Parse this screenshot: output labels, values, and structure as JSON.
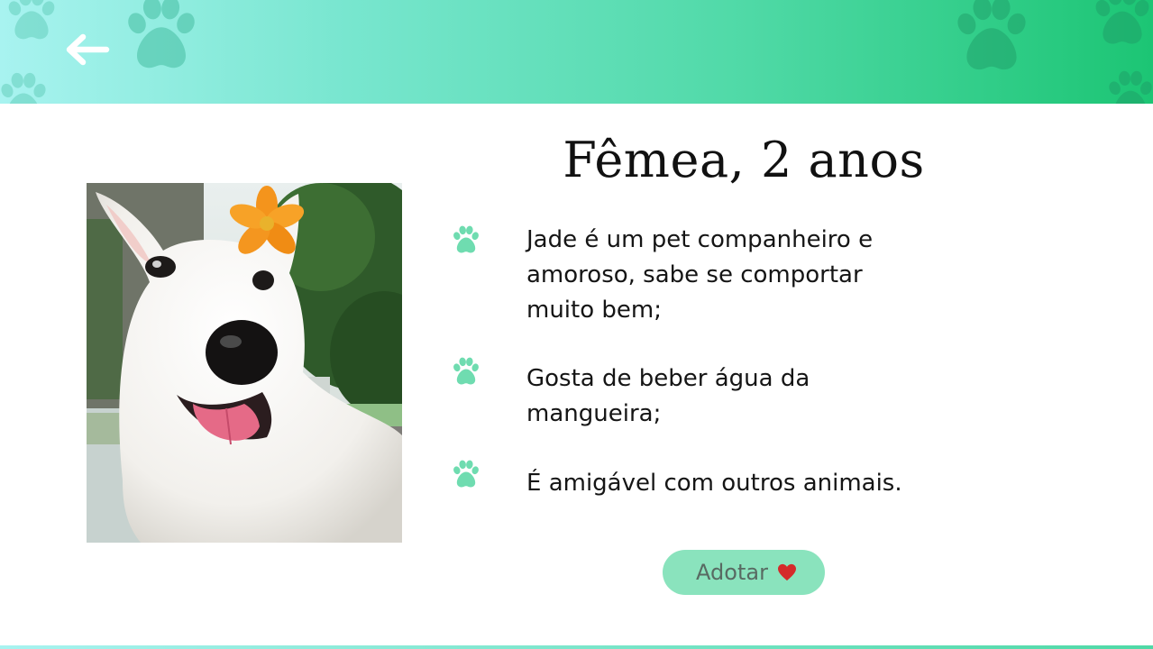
{
  "header": {
    "back_icon": "arrow-left-icon",
    "decoration_icon": "paw-icon",
    "gradient": [
      "#a8f3f0",
      "#1cc574"
    ]
  },
  "pet": {
    "title": "Fêmea, 2 anos",
    "photo_icon": "dog-photo"
  },
  "traits": [
    {
      "icon": "paw-icon",
      "text": "Jade é um pet companheiro e amoroso, sabe se comportar muito bem;"
    },
    {
      "icon": "paw-icon",
      "text": "Gosta de beber água da mangueira;"
    },
    {
      "icon": "paw-icon",
      "text": "É amigável com outros animais."
    }
  ],
  "adopt_button": {
    "label": "Adotar",
    "icon": "heart-icon",
    "background": "#8ae3bd",
    "heart_color": "#d42a2a"
  },
  "colors": {
    "paw_accent": "#6fdcb0"
  }
}
